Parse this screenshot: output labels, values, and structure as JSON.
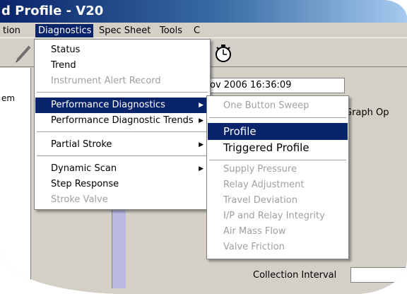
{
  "window": {
    "title": "d Profile - V20"
  },
  "menubar": {
    "items": [
      "tion",
      "Diagnostics",
      "Spec Sheet",
      "Tools",
      "C"
    ]
  },
  "left_panel": {
    "label": "em"
  },
  "datetime": "ov 2006 16:36:09",
  "graph_options": "Graph Op",
  "collection": {
    "label": "Collection Interval"
  },
  "diagnostics_menu": {
    "status": "Status",
    "trend": "Trend",
    "instrument_alert_record": "Instrument Alert Record",
    "performance_diagnostics": "Performance Diagnostics",
    "performance_diagnostic_trends": "Performance Diagnostic Trends",
    "partial_stroke": "Partial Stroke",
    "dynamic_scan": "Dynamic Scan",
    "step_response": "Step Response",
    "stroke_valve": "Stroke Valve"
  },
  "performance_submenu": {
    "one_button_sweep": "One Button Sweep",
    "profile": "Profile",
    "triggered_profile": "Triggered Profile",
    "supply_pressure": "Supply Pressure",
    "relay_adjustment": "Relay Adjustment",
    "travel_deviation": "Travel Deviation",
    "ip_relay_integrity": "I/P and Relay Integrity",
    "air_mass_flow": "Air Mass Flow",
    "valve_friction": "Valve Friction"
  },
  "colors": {
    "highlight": "#0a246a",
    "disabled_text": "#a0a0a0",
    "titlebar": "#0a246a"
  },
  "icons": {
    "toolbar_pen": "pen-icon",
    "toolbar_timer": "stopwatch-icon",
    "submenu_arrow": "triangle-right-icon"
  }
}
